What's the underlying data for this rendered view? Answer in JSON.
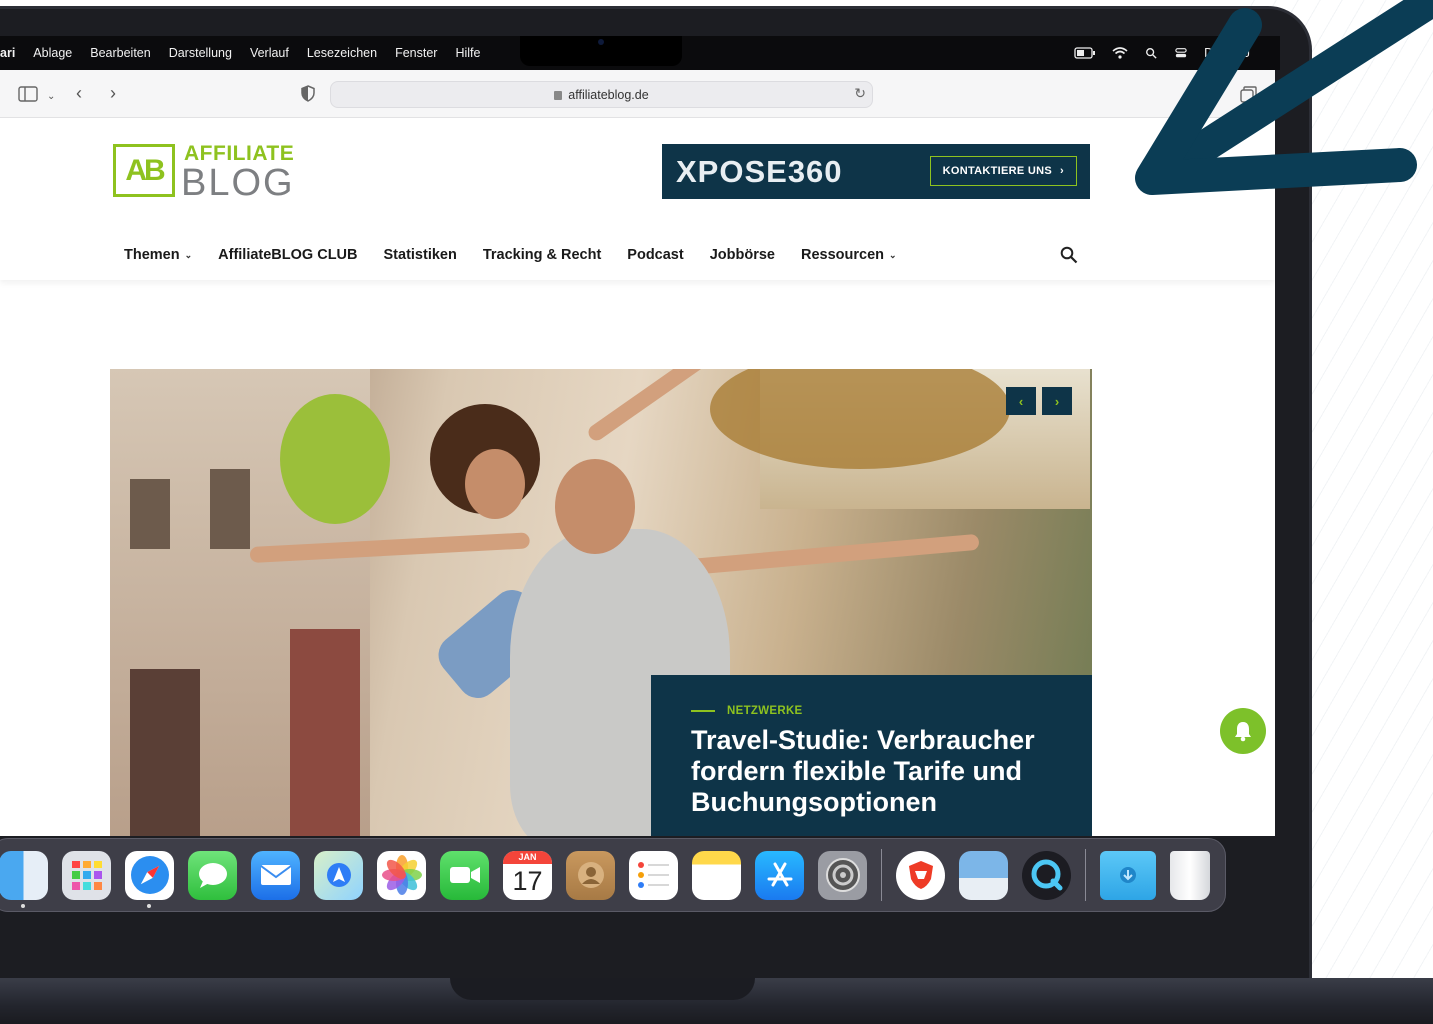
{
  "menubar": {
    "items": [
      "ari",
      "Ablage",
      "Bearbeiten",
      "Darstellung",
      "Verlauf",
      "Lesezeichen",
      "Fenster",
      "Hilfe"
    ],
    "clock": "Di. 17. J"
  },
  "browser": {
    "url": "affiliateblog.de"
  },
  "site": {
    "logo_mark": "AB",
    "logo_top": "AFFILIATE",
    "logo_bottom": "BLOG",
    "ad_brand": "XPOSE360",
    "ad_cta": "KONTAKTIERE UNS",
    "nav": [
      {
        "label": "Themen",
        "dropdown": true
      },
      {
        "label": "AffiliateBLOG CLUB",
        "dropdown": false
      },
      {
        "label": "Statistiken",
        "dropdown": false
      },
      {
        "label": "Tracking & Recht",
        "dropdown": false
      },
      {
        "label": "Podcast",
        "dropdown": false
      },
      {
        "label": "Jobbörse",
        "dropdown": false
      },
      {
        "label": "Ressourcen",
        "dropdown": true
      }
    ]
  },
  "hero": {
    "category": "NETZWERKE",
    "headline": "Travel-Studie: Verbraucher fordern flexible Tarife und Buchungsoptionen",
    "prev": "‹",
    "next": "›"
  },
  "dock": {
    "calendar_month": "JAN",
    "calendar_day": "17",
    "apps": [
      "finder",
      "launchpad",
      "safari",
      "messages",
      "mail",
      "maps",
      "photos",
      "facetime",
      "calendar",
      "contacts",
      "reminders",
      "notes",
      "app-store",
      "system-settings",
      "brave-like",
      "preview",
      "quicktime",
      "downloads",
      "trash"
    ]
  },
  "colors": {
    "brand_green": "#8ec21f",
    "brand_navy": "#0e3448",
    "annotation": "#0b3d55"
  }
}
